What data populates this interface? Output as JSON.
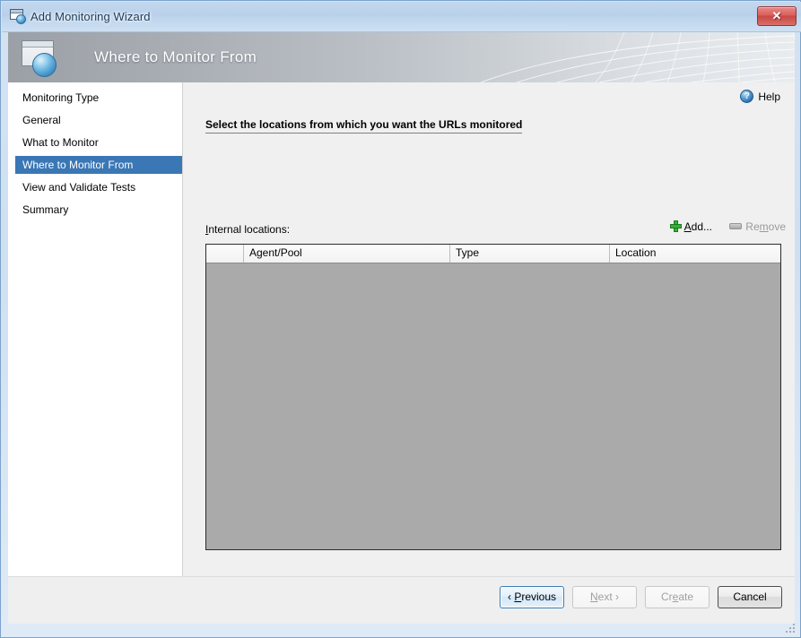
{
  "window": {
    "title": "Add Monitoring Wizard",
    "icon": "wizard-window-icon",
    "close_label": "✕"
  },
  "banner": {
    "title": "Where to Monitor From",
    "icon": "wizard-banner-icon"
  },
  "sidebar": {
    "items": [
      {
        "label": "Monitoring Type",
        "selected": false
      },
      {
        "label": "General",
        "selected": false
      },
      {
        "label": "What to Monitor",
        "selected": false
      },
      {
        "label": "Where to Monitor From",
        "selected": true
      },
      {
        "label": "View and Validate Tests",
        "selected": false
      },
      {
        "label": "Summary",
        "selected": false
      }
    ],
    "selected_color": "#3a77b5"
  },
  "content": {
    "help_label": "Help",
    "help_icon": "help-question-icon",
    "heading": "Select the locations from which you want the URLs monitored",
    "list_label_prefix": "I",
    "list_label_rest": "nternal locations:",
    "add_label_prefix": "A",
    "add_label_rest": "dd...",
    "add_icon": "green-plus-icon",
    "remove_label_prefix": "Re",
    "remove_label_mid": "m",
    "remove_label_rest": "ove",
    "remove_icon": "remove-bar-icon",
    "remove_enabled": false
  },
  "grid": {
    "columns": [
      "",
      "Agent/Pool",
      "Type",
      "Location"
    ],
    "rows": [],
    "empty_background": "#aaaaaa"
  },
  "footer": {
    "previous_label": "‹ Previous",
    "previous_prefix": "‹ ",
    "previous_accel": "P",
    "previous_rest": "revious",
    "next_prefix": "N",
    "next_rest": "ext ›",
    "create_prefix": "Cr",
    "create_accel": "e",
    "create_rest": "ate",
    "cancel_label": "Cancel"
  }
}
